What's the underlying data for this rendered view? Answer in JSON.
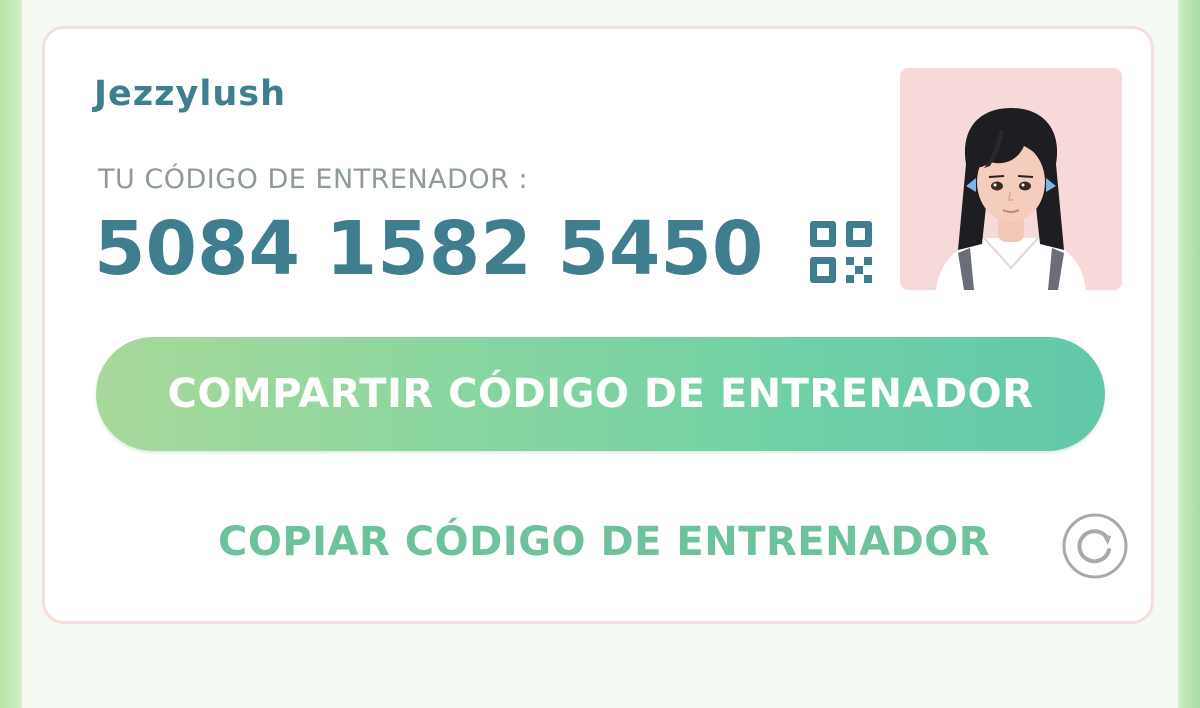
{
  "profile": {
    "trainer_name": "Jezzylush",
    "code_label": "TU CÓDIGO DE ENTRENADOR :",
    "trainer_code": "5084 1582 5450"
  },
  "actions": {
    "share_label": "COMPARTIR CÓDIGO DE ENTRENADOR",
    "copy_label": "COPIAR CÓDIGO DE ENTRENADOR"
  },
  "icons": {
    "qr": "qr-code-icon",
    "refresh": "refresh-icon",
    "avatar": "trainer-avatar"
  },
  "colors": {
    "accent_teal": "#3e7e8e",
    "label_gray": "#8f9a9c",
    "button_gradient_start": "#a8d89a",
    "button_gradient_end": "#62c8aa",
    "copy_green": "#6cc29a",
    "avatar_background": "#f7d9da"
  }
}
